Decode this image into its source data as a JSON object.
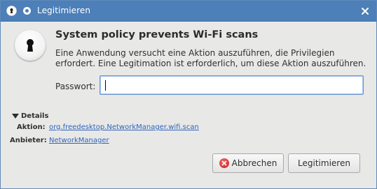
{
  "titlebar": {
    "title": "Legitimieren",
    "icons": [
      "keyhole-icon",
      "dot-icon",
      "close-icon"
    ]
  },
  "dialog": {
    "heading": "System policy prevents Wi-Fi scans",
    "description": "Eine Anwendung versucht eine Aktion auszuführen, die Privilegien erfordert. Eine Legitimation ist erforderlich, um diese Aktion auszuführen.",
    "password_label": "Passwort:",
    "password_value": ""
  },
  "details": {
    "toggle_label": "Details",
    "action_label": "Aktion:",
    "action_value": "org.freedesktop.NetworkManager.wifi.scan",
    "vendor_label": "Anbieter:",
    "vendor_value": "NetworkManager"
  },
  "buttons": {
    "cancel_label": "Abbrechen",
    "authenticate_label": "Legitimieren"
  },
  "colors": {
    "titlebar": "#4d7fb8",
    "background": "#e8e8e7",
    "link": "#2f64b8",
    "focus": "#6b96cf"
  }
}
